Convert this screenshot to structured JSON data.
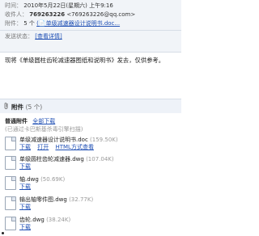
{
  "header": {
    "time_label": "时间：",
    "time_value": "2010年5月22日(星期六) 上午9:16",
    "recipient_label": "收件人：",
    "recipient_name": "769263226",
    "recipient_email": "<769263226@qq.com>",
    "attachment_label": "附件：",
    "attachment_count": "5 个",
    "attachment_preview": "(📄单级减速器设计说明书.doc...",
    "sender_status_label": "发送状态：",
    "sender_status_link": "[查看详情]"
  },
  "body": {
    "text": "现将《单级圆柱齿轮减速器图纸和说明书》发去，仅供参考。"
  },
  "attachments": {
    "title": "附件",
    "count": "(5 个)",
    "ordinary_label": "普通附件",
    "download_all": "全部下载",
    "hint": "(已通过卡巴斯基杀毒引擎扫描)",
    "files": [
      {
        "name": "单级减速器设计说明书.doc",
        "size": "(159.50K)",
        "actions": [
          "下载",
          "打开",
          "HTML方式查看"
        ]
      },
      {
        "name": "单级圆柱齿轮减速器.dwg",
        "size": "(107.04K)",
        "actions": [
          "下载"
        ]
      },
      {
        "name": "轴.dwg",
        "size": "(50.69K)",
        "actions": [
          "下载"
        ]
      },
      {
        "name": "输出轴零件图.dwg",
        "size": "(32.77K)",
        "actions": [
          "下载"
        ]
      },
      {
        "name": "齿轮.dwg",
        "size": "(38.24K)",
        "actions": [
          "下载"
        ]
      }
    ]
  },
  "colors": {
    "link": "#1f4fb4",
    "header_bg": "#f1f4f8",
    "muted": "#999999"
  }
}
